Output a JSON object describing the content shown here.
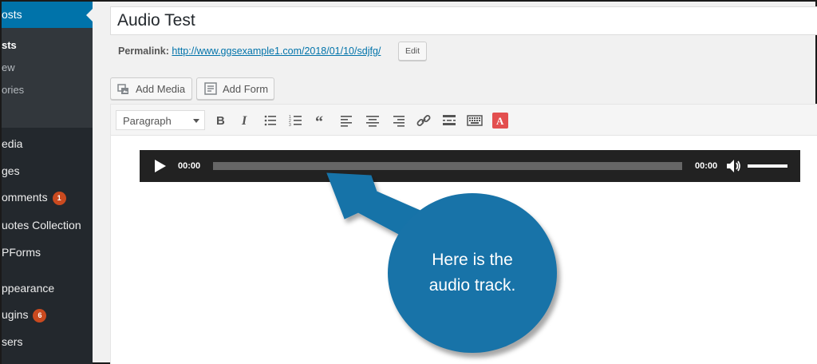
{
  "sidebar": {
    "active_label": "osts",
    "submenu": [
      {
        "label": "sts",
        "current": true
      },
      {
        "label": "ew",
        "current": false
      },
      {
        "label": "ories",
        "current": false
      }
    ],
    "items": [
      {
        "label": "edia"
      },
      {
        "label": "ges"
      },
      {
        "label": "omments",
        "badge": "1"
      },
      {
        "label": "uotes Collection"
      },
      {
        "label": "PForms"
      },
      {
        "label": "ppearance"
      },
      {
        "label": "ugins",
        "badge": "6"
      },
      {
        "label": "sers"
      }
    ]
  },
  "post": {
    "title": "Audio Test",
    "permalink_label": "Permalink:",
    "permalink_url": "http://www.ggsexample1.com/2018/01/10/sdjfg/",
    "edit_label": "Edit"
  },
  "media_buttons": {
    "add_media": "Add Media",
    "add_form": "Add Form"
  },
  "toolbar": {
    "format_value": "Paragraph",
    "icons": [
      "bold-icon",
      "italic-icon",
      "bullet-list-icon",
      "numbered-list-icon",
      "blockquote-icon",
      "align-left-icon",
      "align-center-icon",
      "align-right-icon",
      "link-icon",
      "read-more-icon",
      "toolbar-toggle-icon",
      "wpforms-icon"
    ]
  },
  "player": {
    "current_time": "00:00",
    "duration": "00:00",
    "progress": 0,
    "volume": 1.0
  },
  "callout": {
    "line1": "Here is the",
    "line2": "audio track."
  },
  "colors": {
    "sidebar_bg": "#23282d",
    "accent": "#0073aa",
    "badge": "#ca4a1f",
    "callout": "#1873a8",
    "player_bg": "#222222"
  }
}
